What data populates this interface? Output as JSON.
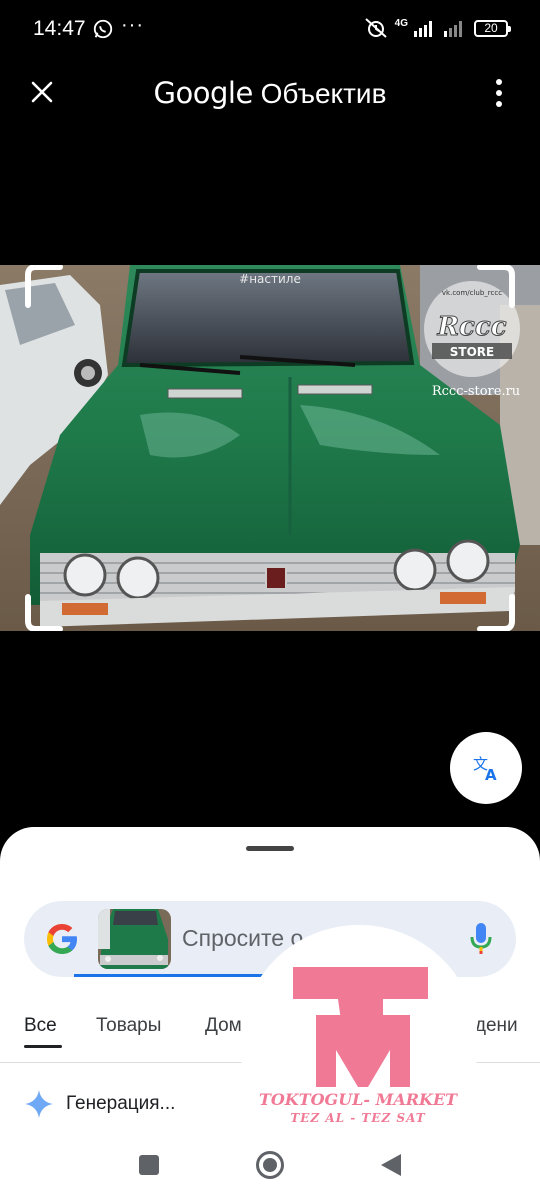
{
  "status_bar": {
    "time": "14:47",
    "more": "···",
    "network": "4G",
    "battery": "20"
  },
  "app_bar": {
    "title_brand": "Google",
    "title_product": "Объектив"
  },
  "photo": {
    "windshield_sticker": "#настиле",
    "watermark_top": "vk.com/club_rccc",
    "watermark_logo": "Rccc",
    "watermark_store": "STORE",
    "watermark_site": "Rccc-store.ru"
  },
  "search": {
    "placeholder": "Спросите о ... ес"
  },
  "tabs": [
    {
      "label": "Все"
    },
    {
      "label": "Товары"
    },
    {
      "label": "Дом"
    },
    {
      "label": "падени"
    }
  ],
  "generation": {
    "label": "Генерация..."
  },
  "overlay_watermark": {
    "line1": "TOKTOGUL- MARKET",
    "line2": "TEZ AL - TEZ SAT"
  },
  "colors": {
    "accent": "#1a73e8",
    "car_green": "#1f7a4a",
    "watermark_pink": "#f07a95"
  }
}
